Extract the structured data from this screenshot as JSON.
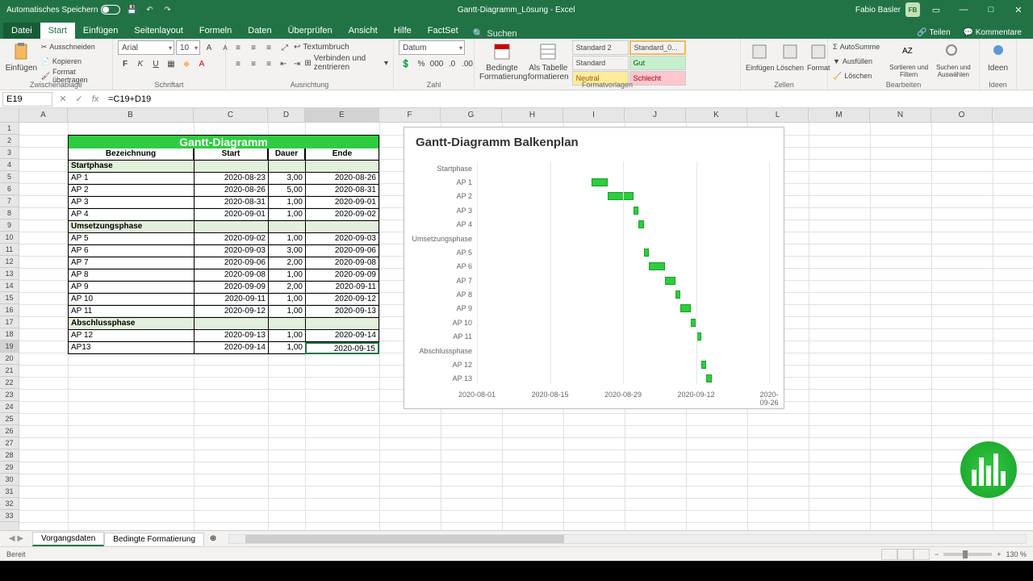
{
  "titlebar": {
    "autosave": "Automatisches Speichern",
    "doc_title": "Gantt-Diagramm_Lösung - Excel",
    "user_name": "Fabio Basler",
    "user_initials": "FB"
  },
  "tabs": {
    "file": "Datei",
    "start": "Start",
    "insert": "Einfügen",
    "layout": "Seitenlayout",
    "formulas": "Formeln",
    "data": "Daten",
    "review": "Überprüfen",
    "view": "Ansicht",
    "help": "Hilfe",
    "factset": "FactSet",
    "search": "Suchen",
    "share": "Teilen",
    "comments": "Kommentare"
  },
  "ribbon": {
    "paste": "Einfügen",
    "cut": "Ausschneiden",
    "copy": "Kopieren",
    "format_painter": "Format übertragen",
    "clipboard": "Zwischenablage",
    "font_name": "Arial",
    "font_size": "10",
    "font": "Schriftart",
    "wrap": "Textumbruch",
    "merge": "Verbinden und zentrieren",
    "alignment": "Ausrichtung",
    "num_format": "Datum",
    "number": "Zahl",
    "cond_fmt": "Bedingte Formatierung",
    "as_table": "Als Tabelle formatieren",
    "styles": "Formatvorlagen",
    "style_std2": "Standard 2",
    "style_std0": "Standard_0...",
    "style_std": "Standard",
    "style_good": "Gut",
    "style_neutral": "Neutral",
    "style_bad": "Schlecht",
    "insert_cells": "Einfügen",
    "delete_cells": "Löschen",
    "format_cells": "Format",
    "cells": "Zellen",
    "autosum": "AutoSumme",
    "fill": "Ausfüllen",
    "clear": "Löschen",
    "sort": "Sortieren und Filtern",
    "find": "Suchen und Auswählen",
    "editing": "Bearbeiten",
    "ideas": "Ideen"
  },
  "fbar": {
    "cell_ref": "E19",
    "formula": "=C19+D19"
  },
  "columns": [
    "A",
    "B",
    "C",
    "D",
    "E",
    "F",
    "G",
    "H",
    "I",
    "J",
    "K",
    "L",
    "M",
    "N",
    "O"
  ],
  "table": {
    "title": "Gantt-Diagramm",
    "headers": [
      "Bezeichnung",
      "Start",
      "Dauer",
      "Ende"
    ],
    "rows": [
      {
        "phase": true,
        "b": "Startphase",
        "c": "",
        "d": "",
        "e": ""
      },
      {
        "phase": false,
        "b": "AP 1",
        "c": "2020-08-23",
        "d": "3,00",
        "e": "2020-08-26"
      },
      {
        "phase": false,
        "b": "AP 2",
        "c": "2020-08-26",
        "d": "5,00",
        "e": "2020-08-31"
      },
      {
        "phase": false,
        "b": "AP 3",
        "c": "2020-08-31",
        "d": "1,00",
        "e": "2020-09-01"
      },
      {
        "phase": false,
        "b": "AP 4",
        "c": "2020-09-01",
        "d": "1,00",
        "e": "2020-09-02"
      },
      {
        "phase": true,
        "b": "Umsetzungsphase",
        "c": "",
        "d": "",
        "e": ""
      },
      {
        "phase": false,
        "b": "AP 5",
        "c": "2020-09-02",
        "d": "1,00",
        "e": "2020-09-03"
      },
      {
        "phase": false,
        "b": "AP 6",
        "c": "2020-09-03",
        "d": "3,00",
        "e": "2020-09-06"
      },
      {
        "phase": false,
        "b": "AP 7",
        "c": "2020-09-06",
        "d": "2,00",
        "e": "2020-09-08"
      },
      {
        "phase": false,
        "b": "AP 8",
        "c": "2020-09-08",
        "d": "1,00",
        "e": "2020-09-09"
      },
      {
        "phase": false,
        "b": "AP 9",
        "c": "2020-09-09",
        "d": "2,00",
        "e": "2020-09-11"
      },
      {
        "phase": false,
        "b": "AP 10",
        "c": "2020-09-11",
        "d": "1,00",
        "e": "2020-09-12"
      },
      {
        "phase": false,
        "b": "AP 11",
        "c": "2020-09-12",
        "d": "1,00",
        "e": "2020-09-13"
      },
      {
        "phase": true,
        "b": "Abschlussphase",
        "c": "",
        "d": "",
        "e": ""
      },
      {
        "phase": false,
        "b": "AP 12",
        "c": "2020-09-13",
        "d": "1,00",
        "e": "2020-09-14"
      },
      {
        "phase": false,
        "b": "AP13",
        "c": "2020-09-14",
        "d": "1,00",
        "e": "2020-09-15"
      }
    ]
  },
  "chart_data": {
    "type": "bar",
    "title": "Gantt-Diagramm Balkenplan",
    "orientation": "horizontal",
    "categories": [
      "Startphase",
      "AP 1",
      "AP 2",
      "AP 3",
      "AP 4",
      "Umsetzungsphase",
      "AP 5",
      "AP 6",
      "AP 7",
      "AP 8",
      "AP 9",
      "AP 10",
      "AP 11",
      "Abschlussphase",
      "AP 12",
      "AP 13"
    ],
    "series": [
      {
        "name": "Start",
        "values": [
          "2020-08-23",
          "2020-08-23",
          "2020-08-26",
          "2020-08-31",
          "2020-09-01",
          "2020-09-02",
          "2020-09-02",
          "2020-09-03",
          "2020-09-06",
          "2020-09-08",
          "2020-09-09",
          "2020-09-11",
          "2020-09-12",
          "2020-09-13",
          "2020-09-13",
          "2020-09-14"
        ]
      },
      {
        "name": "Dauer",
        "values": [
          0,
          3,
          5,
          1,
          1,
          0,
          1,
          3,
          2,
          1,
          2,
          1,
          1,
          0,
          1,
          1
        ]
      }
    ],
    "x_ticks": [
      "2020-08-01",
      "2020-08-15",
      "2020-08-29",
      "2020-09-12",
      "2020-09-26"
    ],
    "xlim": [
      "2020-08-01",
      "2020-09-26"
    ]
  },
  "sheets": {
    "active": "Vorgangsdaten",
    "other": "Bedingte Formatierung"
  },
  "status": {
    "ready": "Bereit",
    "zoom": "130 %"
  }
}
